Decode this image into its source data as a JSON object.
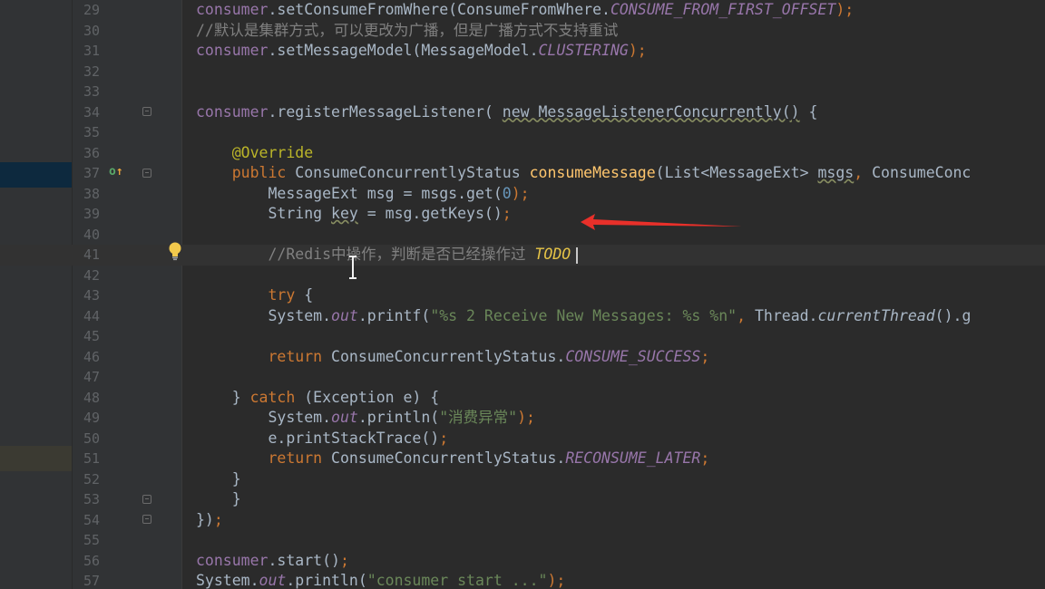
{
  "lines": [
    {
      "n": "29",
      "segs": [
        [
          "consumer",
          "var"
        ],
        [
          ".setConsumeFromWhere(ConsumeFromWhere.",
          ""
        ],
        [
          "CONSUME_FROM_FIRST_OFFSET",
          "stat"
        ],
        [
          ");",
          "kw"
        ]
      ]
    },
    {
      "n": "30",
      "segs": [
        [
          "//默认是集群方式，可以更改为广播，但是广播方式不支持重试",
          "cmt"
        ]
      ]
    },
    {
      "n": "31",
      "segs": [
        [
          "consumer",
          "var"
        ],
        [
          ".setMessageModel(MessageModel.",
          ""
        ],
        [
          "CLUSTERING",
          "stat"
        ],
        [
          ");",
          "kw"
        ]
      ]
    },
    {
      "n": "32",
      "segs": []
    },
    {
      "n": "33",
      "segs": []
    },
    {
      "n": "34",
      "segs": [
        [
          "consumer",
          "var"
        ],
        [
          ".registerMessageListener( ",
          ""
        ],
        [
          "new MessageListenerConcurrently()",
          "warn"
        ],
        [
          " {",
          ""
        ]
      ]
    },
    {
      "n": "35",
      "segs": []
    },
    {
      "n": "36",
      "segs": [
        [
          "    ",
          ""
        ],
        [
          "@Override",
          "ann"
        ]
      ]
    },
    {
      "n": "37",
      "segs": [
        [
          "    ",
          ""
        ],
        [
          "public ",
          "kw"
        ],
        [
          "ConsumeConcurrentlyStatus ",
          ""
        ],
        [
          "consumeMessage",
          "fn"
        ],
        [
          "(List<MessageExt> ",
          ""
        ],
        [
          "msgs",
          "warn"
        ],
        [
          ", ",
          "kw"
        ],
        [
          "ConsumeConc",
          ""
        ]
      ]
    },
    {
      "n": "38",
      "segs": [
        [
          "        MessageExt msg = msgs.get(",
          ""
        ],
        [
          "0",
          "num"
        ],
        [
          ");",
          "kw"
        ]
      ]
    },
    {
      "n": "39",
      "segs": [
        [
          "        String ",
          ""
        ],
        [
          "key",
          "warn"
        ],
        [
          " = msg.getKeys()",
          ""
        ],
        [
          ";",
          "kw"
        ]
      ]
    },
    {
      "n": "40",
      "segs": []
    },
    {
      "n": "41",
      "segs": [
        [
          "        //Redis中操作，判断是否已经操作过 ",
          "cmt"
        ],
        [
          "TODO",
          "todo"
        ]
      ],
      "current": true
    },
    {
      "n": "42",
      "segs": []
    },
    {
      "n": "43",
      "segs": [
        [
          "        ",
          ""
        ],
        [
          "try ",
          "kw"
        ],
        [
          "{",
          ""
        ]
      ]
    },
    {
      "n": "44",
      "segs": [
        [
          "        System.",
          ""
        ],
        [
          "out",
          "stat"
        ],
        [
          ".printf(",
          ""
        ],
        [
          "\"%s 2 Receive New Messages: %s %n\"",
          "str"
        ],
        [
          ", ",
          "kw"
        ],
        [
          "Thread.",
          ""
        ],
        [
          "currentThread",
          "sfn"
        ],
        [
          "().g",
          ""
        ]
      ]
    },
    {
      "n": "45",
      "segs": []
    },
    {
      "n": "46",
      "segs": [
        [
          "        ",
          ""
        ],
        [
          "return ",
          "kw"
        ],
        [
          "ConsumeConcurrentlyStatus.",
          ""
        ],
        [
          "CONSUME_SUCCESS",
          "stat"
        ],
        [
          ";",
          "kw"
        ]
      ]
    },
    {
      "n": "47",
      "segs": []
    },
    {
      "n": "48",
      "segs": [
        [
          "    } ",
          ""
        ],
        [
          "catch ",
          "kw"
        ],
        [
          "(Exception e) {",
          ""
        ]
      ]
    },
    {
      "n": "49",
      "segs": [
        [
          "        System.",
          ""
        ],
        [
          "out",
          "stat"
        ],
        [
          ".println(",
          ""
        ],
        [
          "\"消费异常\"",
          "str"
        ],
        [
          ");",
          "kw"
        ]
      ]
    },
    {
      "n": "50",
      "segs": [
        [
          "        e.printStackTrace()",
          ""
        ],
        [
          ";",
          "kw"
        ]
      ]
    },
    {
      "n": "51",
      "segs": [
        [
          "        ",
          ""
        ],
        [
          "return ",
          "kw"
        ],
        [
          "ConsumeConcurrentlyStatus.",
          ""
        ],
        [
          "RECONSUME_LATER",
          "stat"
        ],
        [
          ";",
          "kw"
        ]
      ]
    },
    {
      "n": "52",
      "segs": [
        [
          "    }",
          ""
        ]
      ]
    },
    {
      "n": "53",
      "segs": [
        [
          "    }",
          ""
        ]
      ]
    },
    {
      "n": "54",
      "segs": [
        [
          "})",
          ""
        ],
        [
          ";",
          "kw"
        ]
      ]
    },
    {
      "n": "55",
      "segs": []
    },
    {
      "n": "56",
      "segs": [
        [
          "consumer",
          "var"
        ],
        [
          ".start()",
          ""
        ],
        [
          ";",
          "kw"
        ]
      ]
    },
    {
      "n": "57",
      "segs": [
        [
          "System.",
          ""
        ],
        [
          "out",
          "stat"
        ],
        [
          ".println(",
          ""
        ],
        [
          "\"consumer start ...\"",
          "str"
        ],
        [
          ");",
          "kw"
        ]
      ]
    }
  ],
  "colors": {
    "background": "#2b2b2b",
    "gutter": "#313335",
    "text": "#a9b7c6",
    "keyword": "#cc7832",
    "string": "#6a8759",
    "comment": "#808080",
    "field": "#9876aa",
    "method": "#ffc66d",
    "annotation": "#bbb529",
    "todo": "#e6c447",
    "arrow": "#e8302a"
  },
  "icons": {
    "override": "override-implements-icon",
    "bulb": "intention-bulb-icon",
    "fold": "fold-marker-icon",
    "cursor": "text-ibeam-cursor-icon",
    "arrow": "red-annotation-arrow"
  }
}
